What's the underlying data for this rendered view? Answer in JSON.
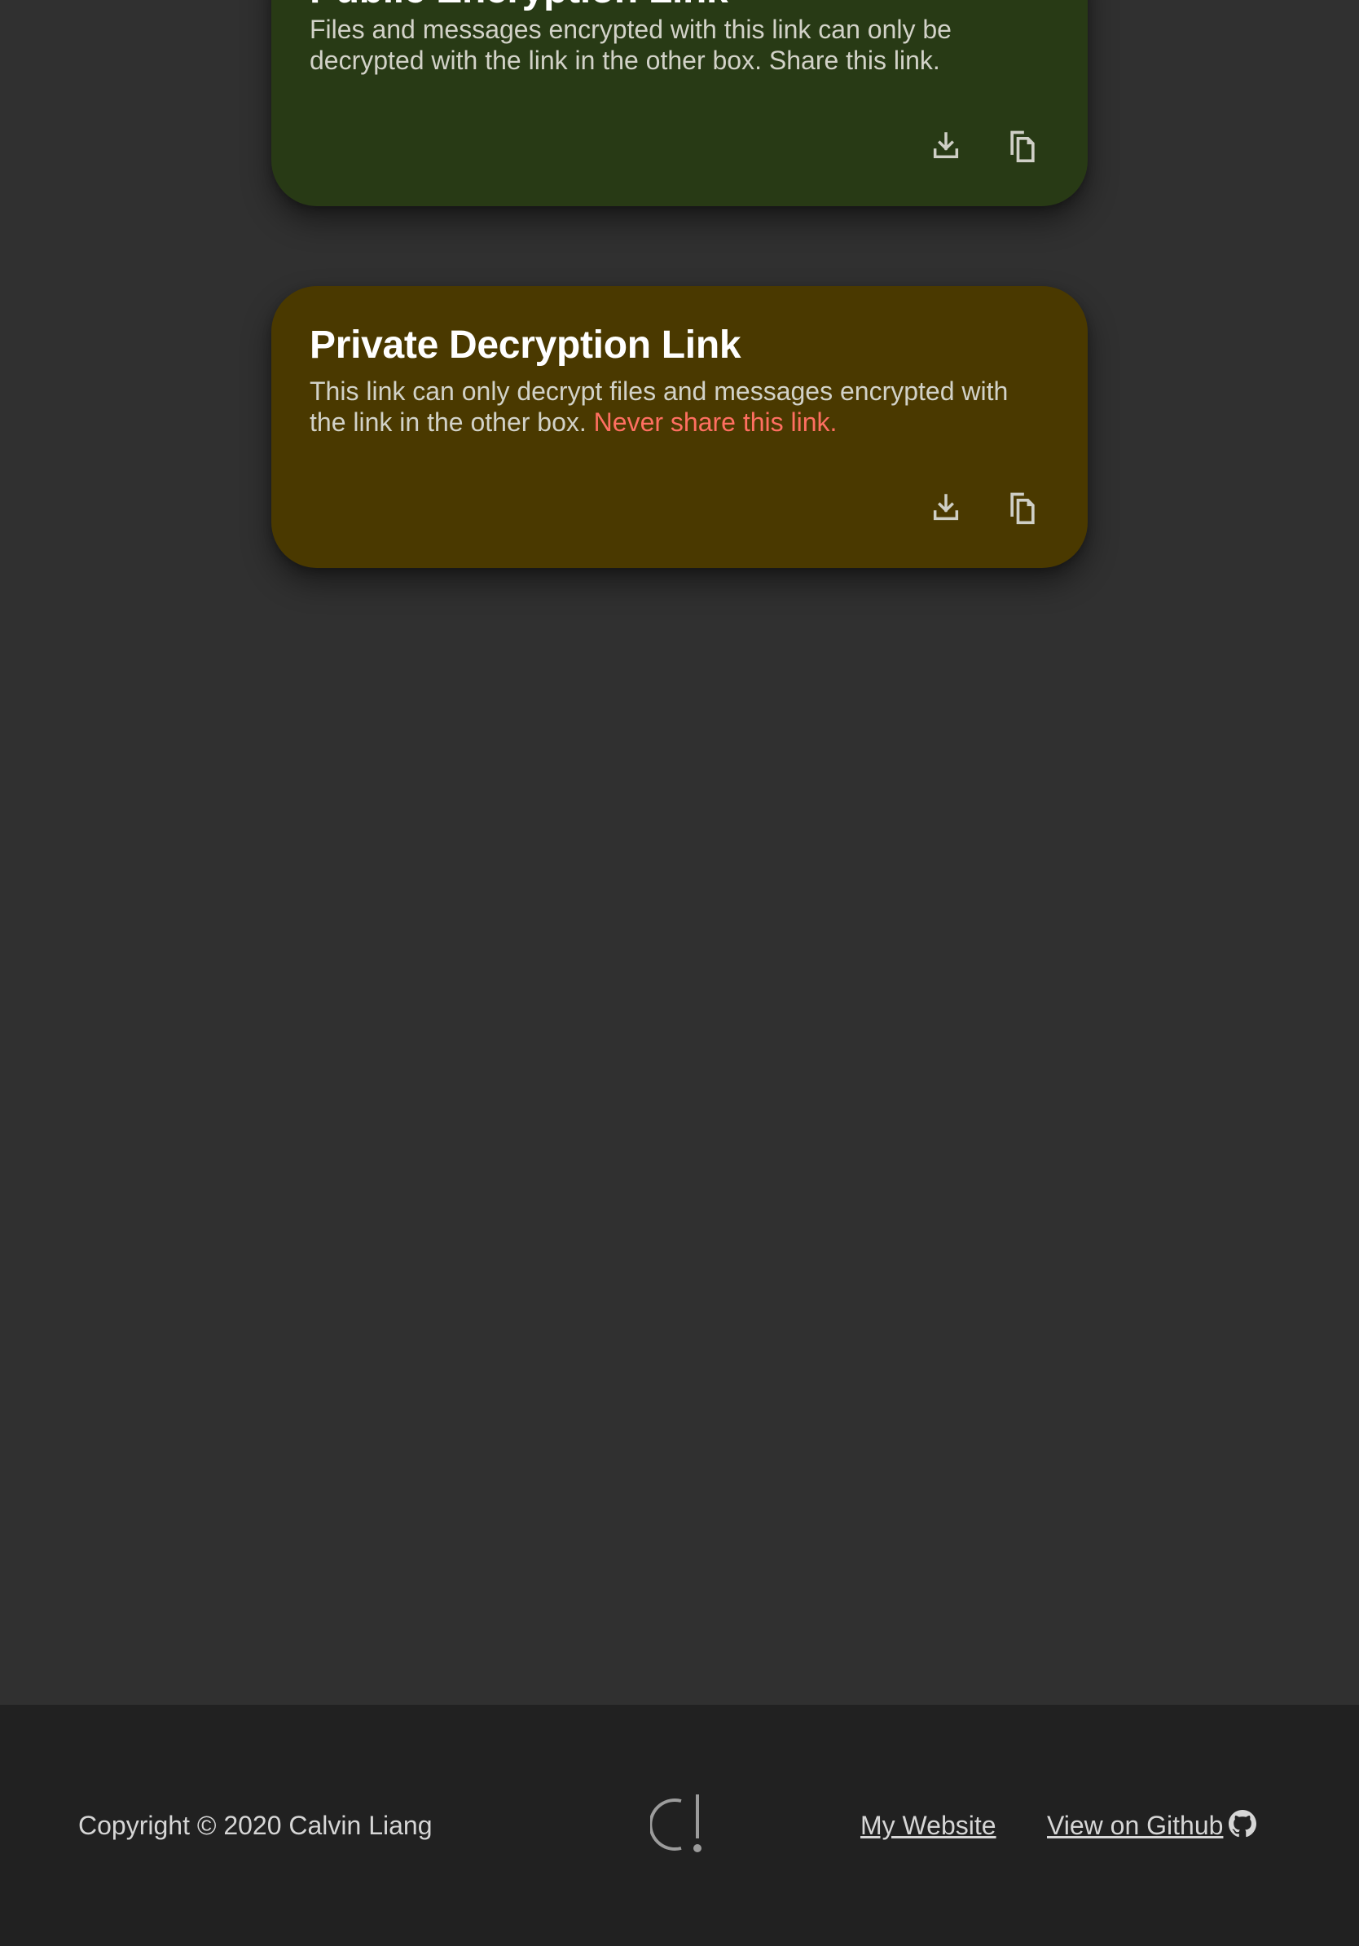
{
  "cards": {
    "public": {
      "title": "Public Encryption Link",
      "description": "Files and messages encrypted with this link can only be decrypted with the link in the other box. Share this link.",
      "color": "#283a15"
    },
    "private": {
      "title": "Private Decryption Link",
      "description": "This link can only decrypt files and messages encrypted with the link in the other box.",
      "warning": "Never share this link.",
      "color": "#4a3900",
      "warning_color": "#ff6f61"
    }
  },
  "icons": {
    "download": "download-icon",
    "copy": "copy-icon",
    "github": "github-icon",
    "logo": "cl-logo"
  },
  "footer": {
    "copyright": "Copyright © 2020 Calvin Liang",
    "links": {
      "website": "My Website",
      "github": "View on Github"
    },
    "background": "#212121"
  },
  "page": {
    "background": "#303030"
  }
}
